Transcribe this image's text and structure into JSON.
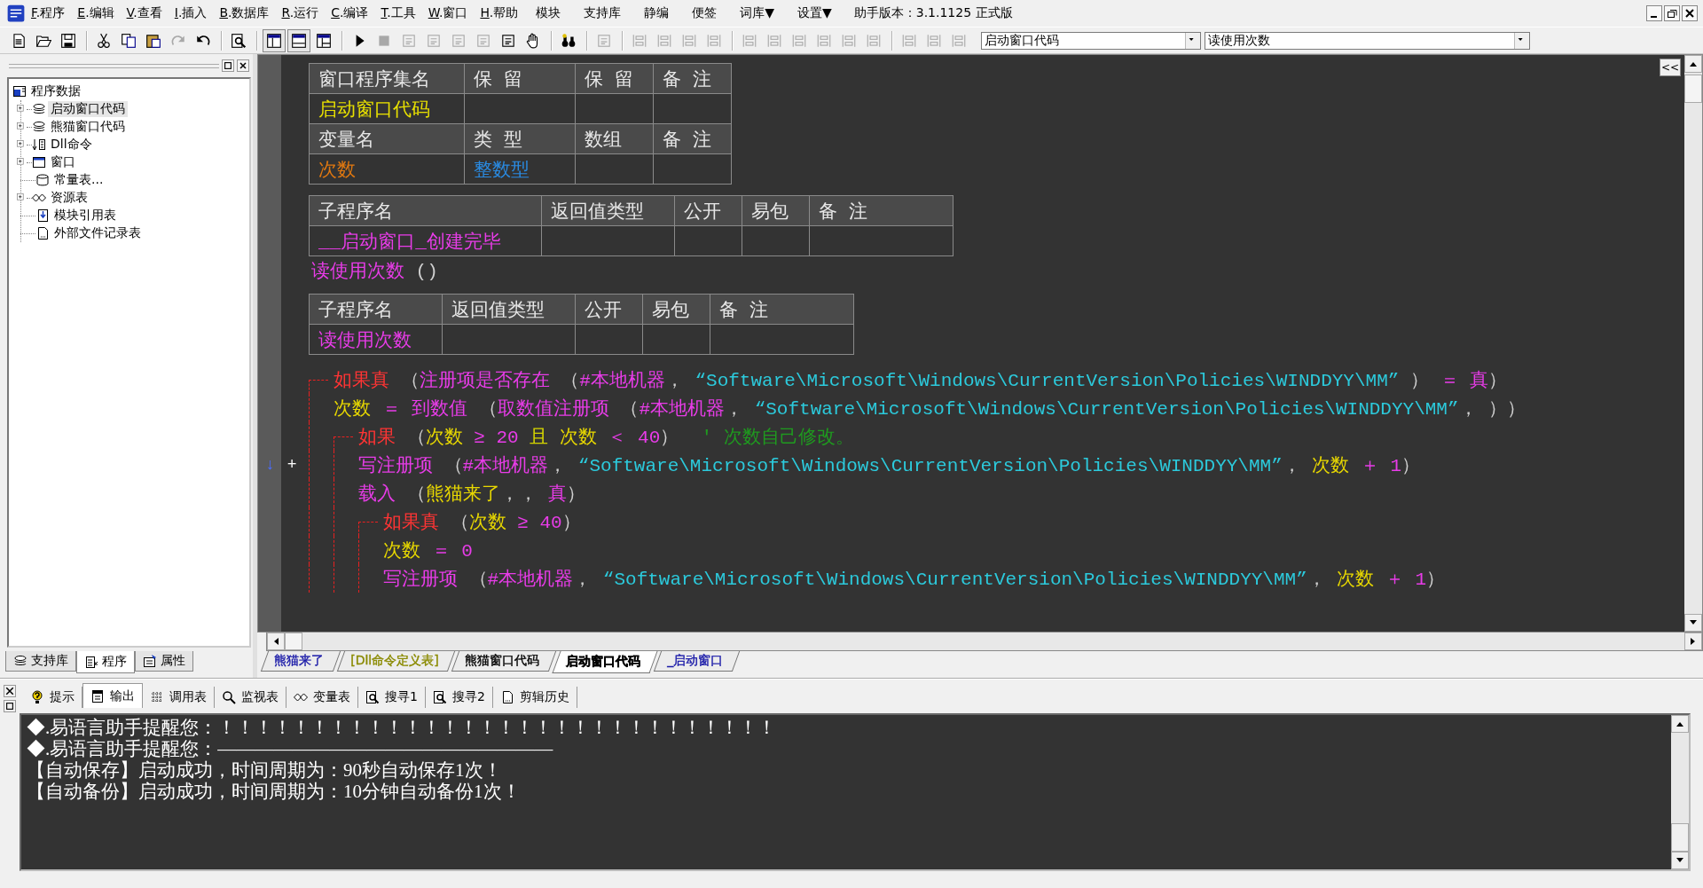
{
  "menu": [
    {
      "label": "F.程序",
      "kind": "mnemonic"
    },
    {
      "label": "E.编辑",
      "kind": "mnemonic"
    },
    {
      "label": "V.查看",
      "kind": "mnemonic"
    },
    {
      "label": "I.插入",
      "kind": "mnemonic"
    },
    {
      "label": "B.数据库",
      "kind": "mnemonic"
    },
    {
      "label": "R.运行",
      "kind": "mnemonic"
    },
    {
      "label": "C.编译",
      "kind": "mnemonic"
    },
    {
      "label": "T.工具",
      "kind": "mnemonic"
    },
    {
      "label": "W.窗口",
      "kind": "mnemonic"
    },
    {
      "label": "H.帮助",
      "kind": "mnemonic"
    },
    {
      "label": "模块",
      "kind": "plain"
    },
    {
      "label": "支持库",
      "kind": "plain"
    },
    {
      "label": "静编",
      "kind": "plain"
    },
    {
      "label": "便签",
      "kind": "plain"
    },
    {
      "label": "词库▼",
      "kind": "plain"
    },
    {
      "label": "设置▼",
      "kind": "plain"
    }
  ],
  "version": "助手版本：3.1.1125 正式版",
  "toolbar": [
    {
      "disabled": false
    },
    {
      "disabled": false
    },
    {
      "disabled": false
    },
    {
      "disabled": false
    },
    {
      "disabled": false
    },
    {
      "disabled": false
    },
    {
      "disabled": true
    },
    {
      "disabled": false
    },
    {
      "disabled": false
    },
    {
      "disabled": false
    },
    {
      "disabled": false
    },
    {
      "disabled": false
    },
    {
      "disabled": false
    },
    {
      "disabled": true
    },
    {
      "disabled": true
    },
    {
      "disabled": true
    },
    {
      "disabled": true
    },
    {
      "disabled": true
    },
    {
      "disabled": false
    },
    {
      "disabled": false
    },
    {
      "disabled": false
    },
    {
      "disabled": true
    },
    {
      "disabled": true
    },
    {
      "disabled": true
    },
    {
      "disabled": true
    },
    {
      "disabled": true
    },
    {
      "disabled": true
    },
    {
      "disabled": true
    },
    {
      "disabled": true
    },
    {
      "disabled": true
    },
    {
      "disabled": true
    },
    {
      "disabled": true
    },
    {
      "disabled": true
    },
    {
      "disabled": true
    },
    {
      "disabled": true
    }
  ],
  "combos": [
    {
      "value": "启动窗口代码"
    },
    {
      "value": "读使用次数"
    }
  ],
  "tree": {
    "label": "程序数据",
    "children": [
      {
        "label": "启动窗口代码",
        "kind": "group",
        "expanded": false,
        "selected": true
      },
      {
        "label": "熊猫窗口代码",
        "kind": "group",
        "expanded": false,
        "selected": false
      },
      {
        "label": "Dll命令",
        "kind": "group",
        "expanded": false,
        "selected": false
      },
      {
        "label": "窗口",
        "kind": "group",
        "expanded": false,
        "selected": false
      },
      {
        "label": "常量表...",
        "kind": "leaf",
        "selected": false
      },
      {
        "label": "资源表",
        "kind": "group",
        "expanded": false,
        "selected": false
      },
      {
        "label": "模块引用表",
        "kind": "leaf",
        "selected": false
      },
      {
        "label": "外部文件记录表",
        "kind": "leaf",
        "selected": false
      }
    ]
  },
  "panel_tabs": [
    {
      "label": "支持库",
      "selected": false
    },
    {
      "label": "程序",
      "selected": true
    },
    {
      "label": "属性",
      "selected": false
    }
  ],
  "editor": {
    "collapse_button": "<<",
    "sections": [
      {
        "kind": "table",
        "rows": [
          {
            "kind": "header",
            "cells": [
              {
                "text": "窗口程序集名"
              },
              {
                "text": "保 留"
              },
              {
                "text": "保 留"
              },
              {
                "text": "备 注"
              }
            ]
          },
          {
            "kind": "data",
            "cells": [
              {
                "text": "启动窗口代码",
                "kind": "assembly"
              }
            ]
          },
          {
            "kind": "header",
            "cells": [
              {
                "text": "变量名"
              },
              {
                "text": "类 型"
              },
              {
                "text": "数组"
              },
              {
                "text": "备 注"
              }
            ]
          },
          {
            "kind": "data",
            "cells": [
              {
                "text": "次数",
                "kind": "variable"
              },
              {
                "text": "整数型",
                "kind": "type"
              }
            ]
          }
        ]
      },
      {
        "kind": "table",
        "rows": [
          {
            "kind": "header",
            "cells": [
              {
                "text": "子程序名"
              },
              {
                "text": "返回值类型"
              },
              {
                "text": "公开"
              },
              {
                "text": "易包"
              },
              {
                "text": "备 注"
              }
            ]
          },
          {
            "kind": "data",
            "cells": [
              {
                "text": "__启动窗口_创建完毕",
                "kind": "subroutine"
              }
            ]
          }
        ]
      },
      {
        "kind": "declaration",
        "name": "读使用次数",
        "params": " ()"
      },
      {
        "kind": "table",
        "rows": [
          {
            "kind": "header",
            "cells": [
              {
                "text": "子程序名"
              },
              {
                "text": "返回值类型"
              },
              {
                "text": "公开"
              },
              {
                "text": "易包"
              },
              {
                "text": "备 注"
              }
            ]
          },
          {
            "kind": "data",
            "cells": [
              {
                "text": "读使用次数",
                "kind": "subroutine"
              }
            ]
          }
        ]
      },
      {
        "kind": "code",
        "lines": [
          {
            "kind": "flow",
            "tokens": [
              {
                "kind": "flow",
                "text": "如果真"
              },
              {
                "kind": "punct",
                "text": " （"
              },
              {
                "kind": "cmd",
                "text": "注册项是否存在"
              },
              {
                "kind": "punct",
                "text": " （"
              },
              {
                "kind": "const",
                "text": "#本地机器"
              },
              {
                "kind": "punct",
                "text": "，"
              },
              {
                "kind": "str",
                "text": " “Software\\Microsoft\\Windows\\CurrentVersion\\Policies\\WINDDYY\\MM”"
              },
              {
                "kind": "punct",
                "text": " ）"
              },
              {
                "kind": "op",
                "text": " ＝ "
              },
              {
                "kind": "const",
                "text": "真"
              },
              {
                "kind": "punct",
                "text": "）"
              }
            ],
            "children": [
              {
                "kind": "stmt",
                "tokens": [
                  {
                    "kind": "var",
                    "text": "次数"
                  },
                  {
                    "kind": "op",
                    "text": " ＝ "
                  },
                  {
                    "kind": "cmd",
                    "text": "到数值"
                  },
                  {
                    "kind": "punct",
                    "text": " （"
                  },
                  {
                    "kind": "cmd",
                    "text": "取数值注册项"
                  },
                  {
                    "kind": "punct",
                    "text": " （"
                  },
                  {
                    "kind": "const",
                    "text": "#本地机器"
                  },
                  {
                    "kind": "punct",
                    "text": "，"
                  },
                  {
                    "kind": "str",
                    "text": " “Software\\Microsoft\\Windows\\CurrentVersion\\Policies\\WINDDYY\\MM”"
                  },
                  {
                    "kind": "punct",
                    "text": "， ））"
                  }
                ]
              },
              {
                "kind": "flow",
                "tokens": [
                  {
                    "kind": "flow",
                    "text": "如果"
                  },
                  {
                    "kind": "punct",
                    "text": " （"
                  },
                  {
                    "kind": "var",
                    "text": "次数"
                  },
                  {
                    "kind": "op",
                    "text": " ≥ "
                  },
                  {
                    "kind": "num",
                    "text": "20"
                  },
                  {
                    "kind": "word",
                    "text": " 且 "
                  },
                  {
                    "kind": "var",
                    "text": "次数"
                  },
                  {
                    "kind": "op",
                    "text": " ＜ "
                  },
                  {
                    "kind": "num",
                    "text": "40"
                  },
                  {
                    "kind": "punct",
                    "text": "）"
                  },
                  {
                    "kind": "comment",
                    "text": "  ' 次数自己修改。"
                  }
                ],
                "children": [
                  {
                    "kind": "stmt",
                    "gutter": [
                      "↓",
                      "+"
                    ],
                    "tokens": [
                      {
                        "kind": "cmd",
                        "text": "写注册项"
                      },
                      {
                        "kind": "punct",
                        "text": " （"
                      },
                      {
                        "kind": "const",
                        "text": "#本地机器"
                      },
                      {
                        "kind": "punct",
                        "text": "，"
                      },
                      {
                        "kind": "str",
                        "text": " “Software\\Microsoft\\Windows\\CurrentVersion\\Policies\\WINDDYY\\MM”"
                      },
                      {
                        "kind": "punct",
                        "text": "，"
                      },
                      {
                        "kind": "var",
                        "text": " 次数"
                      },
                      {
                        "kind": "op",
                        "text": " ＋ "
                      },
                      {
                        "kind": "num",
                        "text": "1"
                      },
                      {
                        "kind": "punct",
                        "text": "）"
                      }
                    ]
                  },
                  {
                    "kind": "stmt",
                    "tokens": [
                      {
                        "kind": "cmd",
                        "text": "载入"
                      },
                      {
                        "kind": "punct",
                        "text": " （"
                      },
                      {
                        "kind": "var",
                        "text": "熊猫来了"
                      },
                      {
                        "kind": "punct",
                        "text": "，，"
                      },
                      {
                        "kind": "const",
                        "text": " 真"
                      },
                      {
                        "kind": "punct",
                        "text": "）"
                      }
                    ]
                  },
                  {
                    "kind": "flow",
                    "tokens": [
                      {
                        "kind": "flow",
                        "text": "如果真"
                      },
                      {
                        "kind": "punct",
                        "text": " （"
                      },
                      {
                        "kind": "var",
                        "text": "次数"
                      },
                      {
                        "kind": "op",
                        "text": " ≥ "
                      },
                      {
                        "kind": "num",
                        "text": "40"
                      },
                      {
                        "kind": "punct",
                        "text": "）"
                      }
                    ],
                    "children": [
                      {
                        "kind": "stmt",
                        "tokens": [
                          {
                            "kind": "var",
                            "text": "次数"
                          },
                          {
                            "kind": "op",
                            "text": " ＝ "
                          },
                          {
                            "kind": "num",
                            "text": "0"
                          }
                        ]
                      },
                      {
                        "kind": "stmt",
                        "tokens": [
                          {
                            "kind": "cmd",
                            "text": "写注册项"
                          },
                          {
                            "kind": "punct",
                            "text": " （"
                          },
                          {
                            "kind": "const",
                            "text": "#本地机器"
                          },
                          {
                            "kind": "punct",
                            "text": "，"
                          },
                          {
                            "kind": "str",
                            "text": " “Software\\Microsoft\\Windows\\CurrentVersion\\Policies\\WINDDYY\\MM”"
                          },
                          {
                            "kind": "punct",
                            "text": "，"
                          },
                          {
                            "kind": "var",
                            "text": " 次数"
                          },
                          {
                            "kind": "op",
                            "text": " ＋ "
                          },
                          {
                            "kind": "num",
                            "text": "1"
                          },
                          {
                            "kind": "punct",
                            "text": "）"
                          }
                        ]
                      }
                    ]
                  }
                ]
              }
            ]
          }
        ]
      }
    ]
  },
  "editor_tabs": [
    {
      "label": "熊猫来了",
      "color": "#1a1aa8",
      "selected": false
    },
    {
      "label": "[Dll命令定义表]",
      "color": "#8a8a00",
      "selected": false
    },
    {
      "label": "熊猫窗口代码",
      "color": "#000000",
      "selected": false
    },
    {
      "label": "启动窗口代码",
      "color": "#000000",
      "selected": true
    },
    {
      "label": "_启动窗口",
      "color": "#1a1aa8",
      "selected": false
    }
  ],
  "bottom_tabs": [
    {
      "label": "提示",
      "selected": false
    },
    {
      "label": "输出",
      "selected": true
    },
    {
      "label": "调用表",
      "selected": false
    },
    {
      "label": "监视表",
      "selected": false
    },
    {
      "label": "变量表",
      "selected": false
    },
    {
      "label": "搜寻1",
      "selected": false
    },
    {
      "label": "搜寻2",
      "selected": false
    },
    {
      "label": "剪辑历史",
      "selected": false
    }
  ],
  "output": [
    "◆.易语言助手提醒您：！！！！！！！！！！！！！！！！！！！！！！！！！！！！！！",
    "◆.易语言助手提醒您：——————————————————",
    "【自动保存】启动成功，时间周期为：90秒自动保存1次！",
    "【自动备份】启动成功，时间周期为：10分钟自动备份1次！"
  ]
}
